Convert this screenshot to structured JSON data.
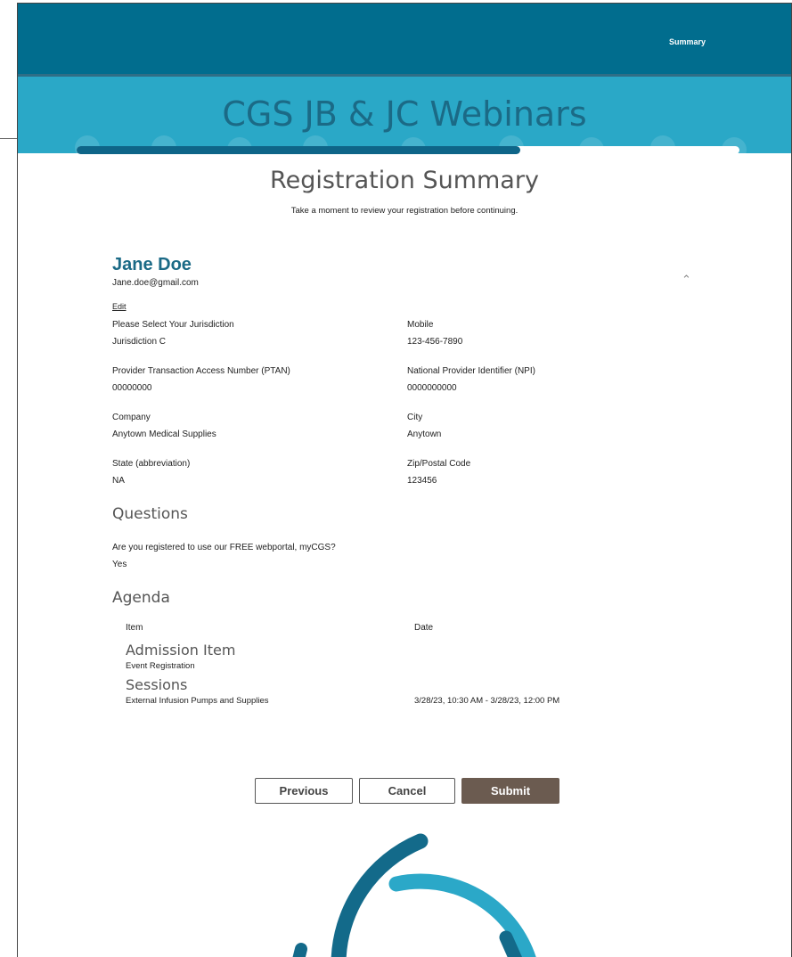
{
  "header": {
    "summary_link": "Summary"
  },
  "banner": {
    "title": "CGS JB & JC Webinars"
  },
  "progress": {
    "percent": 67
  },
  "page": {
    "title": "Registration Summary",
    "subtitle": "Take a moment to review your registration before continuing."
  },
  "attendee": {
    "name": "Jane Doe",
    "email": "Jane.doe@gmail.com",
    "edit_label": "Edit",
    "fields": [
      {
        "label": "Please Select Your Jurisdiction",
        "value": "Jurisdiction C"
      },
      {
        "label": "Mobile",
        "value": "123-456-7890"
      },
      {
        "label": "Provider Transaction Access Number (PTAN)",
        "value": "00000000"
      },
      {
        "label": "National Provider Identifier (NPI)",
        "value": "0000000000"
      },
      {
        "label": "Company",
        "value": "Anytown Medical Supplies"
      },
      {
        "label": "City",
        "value": "Anytown"
      },
      {
        "label": "State (abbreviation)",
        "value": "NA"
      },
      {
        "label": "Zip/Postal Code",
        "value": "123456"
      }
    ]
  },
  "questions": {
    "heading": "Questions",
    "items": [
      {
        "question": "Are you registered to use our FREE webportal, myCGS?",
        "answer": "Yes"
      }
    ]
  },
  "agenda": {
    "heading": "Agenda",
    "col_item": "Item",
    "col_date": "Date",
    "admission_heading": "Admission Item",
    "admission_item": "Event Registration",
    "sessions_heading": "Sessions",
    "session_item": "External Infusion Pumps and Supplies",
    "session_date": "3/28/23, 10:30 AM - 3/28/23, 12:00 PM"
  },
  "buttons": {
    "previous": "Previous",
    "cancel": "Cancel",
    "submit": "Submit"
  },
  "colors": {
    "header": "#016d8e",
    "banner": "#2aa8c7",
    "title_blue": "#1b6a86",
    "submit": "#6b5b50"
  }
}
